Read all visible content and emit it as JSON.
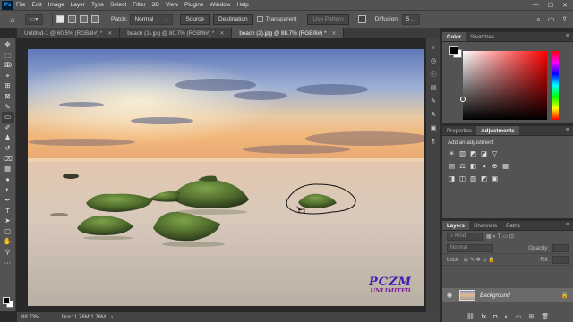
{
  "app": {
    "logo": "Ps",
    "menus": [
      "File",
      "Edit",
      "Image",
      "Layer",
      "Type",
      "Select",
      "Filter",
      "3D",
      "View",
      "Plugins",
      "Window",
      "Help"
    ],
    "window_controls": [
      "—",
      "☐",
      "✕"
    ]
  },
  "options": {
    "home_icon": "home-icon",
    "preset_icon": "patch-tool-icon",
    "patch_label": "Patch:",
    "patch_mode": "Normal",
    "source_label": "Source",
    "destination_label": "Destination",
    "transparent_label": "Transparent",
    "use_pattern_label": "Use Pattern",
    "diffusion_label": "Diffusion:",
    "diffusion_value": "5"
  },
  "tabs": [
    {
      "label": "Untitled-1 @ 60.5% (RGB/8#) *",
      "active": false
    },
    {
      "label": "beach (1).jpg @ 80.7% (RGB/8#) *",
      "active": false
    },
    {
      "label": "beach (2).jpg @ 88.7% (RGB/8#) *",
      "active": true
    }
  ],
  "tools": [
    {
      "glyph": "✥",
      "name": "move-tool-icon"
    },
    {
      "glyph": "⬚",
      "name": "marquee-tool-icon"
    },
    {
      "glyph": "ↂ",
      "name": "lasso-tool-icon"
    },
    {
      "glyph": "⌖",
      "name": "quick-select-tool-icon"
    },
    {
      "glyph": "⊞",
      "name": "crop-tool-icon"
    },
    {
      "glyph": "⊠",
      "name": "frame-tool-icon"
    },
    {
      "glyph": "✎",
      "name": "eyedropper-tool-icon"
    },
    {
      "glyph": "▭",
      "name": "patch-tool-icon"
    },
    {
      "glyph": "✐",
      "name": "brush-tool-icon"
    },
    {
      "glyph": "♟",
      "name": "clone-stamp-tool-icon"
    },
    {
      "glyph": "↺",
      "name": "history-brush-tool-icon"
    },
    {
      "glyph": "⌫",
      "name": "eraser-tool-icon"
    },
    {
      "glyph": "▦",
      "name": "gradient-tool-icon"
    },
    {
      "glyph": "●",
      "name": "blur-tool-icon"
    },
    {
      "glyph": "◐",
      "name": "dodge-tool-icon"
    },
    {
      "glyph": "✒",
      "name": "pen-tool-icon"
    },
    {
      "glyph": "T",
      "name": "type-tool-icon"
    },
    {
      "glyph": "➤",
      "name": "path-select-tool-icon"
    },
    {
      "glyph": "▢",
      "name": "rectangle-tool-icon"
    },
    {
      "glyph": "✋",
      "name": "hand-tool-icon"
    },
    {
      "glyph": "⚲",
      "name": "zoom-tool-icon"
    },
    {
      "glyph": "⋯",
      "name": "edit-toolbar-icon"
    }
  ],
  "status": {
    "zoom": "88.73%",
    "doc": "Doc: 1.76M/1.76M",
    "arrow": "›"
  },
  "color_panel": {
    "tabs": [
      "Color",
      "Swatches"
    ],
    "menu": "≡"
  },
  "adjustments_panel": {
    "tabs": [
      "Properties",
      "Adjustments"
    ],
    "menu": "≡",
    "add_label": "Add an adjustment",
    "rows": [
      [
        "☀",
        "▥",
        "◩",
        "◪",
        "▽"
      ],
      [
        "▤",
        "⚖",
        "◧",
        "◑",
        "⊕",
        "▦"
      ],
      [
        "◨",
        "◫",
        "▧",
        "◩",
        "▣"
      ]
    ]
  },
  "layers_panel": {
    "tabs": [
      "Layers",
      "Channels",
      "Paths"
    ],
    "menu": "≡",
    "filter_label": "Kind",
    "blend_mode": "Normal",
    "opacity_label": "Opacity:",
    "lock_label": "Lock:",
    "fill_label": "Fill:",
    "layer_name": "Background",
    "bottom_icons": [
      "⛓",
      "fx",
      "◘",
      "◐",
      "▭",
      "⊞",
      "🗑"
    ]
  },
  "watermark": {
    "main": "PCZM",
    "sub": "UNLIMITED"
  }
}
